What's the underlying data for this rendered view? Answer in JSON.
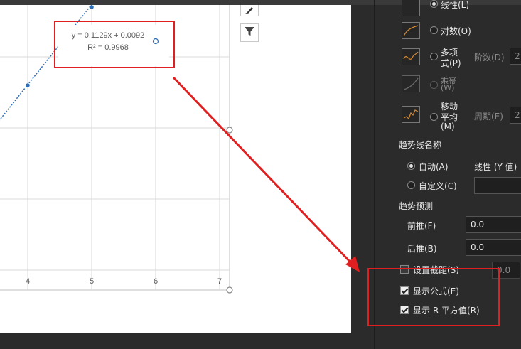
{
  "chart": {
    "equation": "y = 0.1129x + 0.0092",
    "r_squared": "R² = 0.9968"
  },
  "chart_data": {
    "type": "scatter",
    "x": [
      4,
      5,
      6
    ],
    "y": [
      0.46,
      0.57,
      0.69
    ],
    "trendline": {
      "slope": 0.1129,
      "intercept": 0.0092
    },
    "x_ticks": [
      "4",
      "5",
      "6",
      "7"
    ],
    "xlim": [
      3.55,
      7
    ],
    "grid": true
  },
  "side_buttons": {
    "brush_icon": "paintbrush-icon",
    "filter_icon": "filter-icon"
  },
  "panel": {
    "types": {
      "linear": "线性(L)",
      "log": "对数(O)",
      "poly_line1": "多项",
      "poly_line2": "式(P)",
      "order_label": "阶数(D)",
      "order_value": "2",
      "power_line1": "乘幂",
      "power_line2": "(W)",
      "ma_line1": "移动",
      "ma_line2": "平均",
      "ma_line3": "(M)",
      "period_label": "周期(E)",
      "period_value": "2"
    },
    "name_section": {
      "heading": "趋势线名称",
      "auto": "自动(A)",
      "auto_value": "线性 (Y 值)",
      "custom": "自定义(C)"
    },
    "forecast": {
      "heading": "趋势预测",
      "forward_label": "前推(F)",
      "forward_value": "0.0",
      "backward_label": "后推(B)",
      "backward_value": "0.0",
      "intercept_label": "设置截距(S)",
      "intercept_value": "0.0"
    },
    "display": {
      "show_equation": "显示公式(E)",
      "show_r2": "显示 R 平方值(R)"
    }
  },
  "colors": {
    "accent_red": "#e02020",
    "series_blue": "#2e6fb7"
  }
}
